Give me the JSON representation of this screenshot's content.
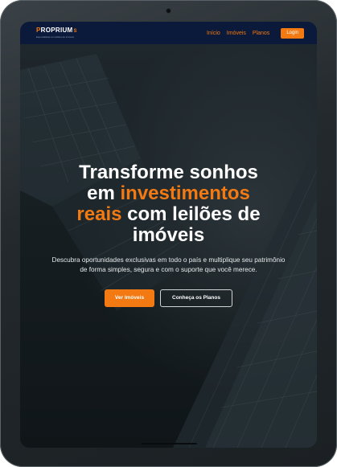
{
  "logo": {
    "p": "P",
    "rest": "ROPRIUM",
    "tail": "S",
    "tagline": "Especialistas em leilões de imóveis"
  },
  "nav": {
    "links": [
      "Início",
      "Imóveis",
      "Planos"
    ],
    "login": "Login"
  },
  "hero": {
    "title_line1": "Transforme sonhos",
    "title_em": "em ",
    "title_accent1": "investimentos",
    "title_accent2": "reais",
    "title_mid": " com leilões de",
    "title_line4": "imóveis",
    "subtitle": "Descubra oportunidades exclusivas em todo o país e multiplique seu patrimônio de forma simples, segura e com o suporte que você merece.",
    "cta_primary": "Ver Imóveis",
    "cta_secondary": "Conheça os Planos"
  },
  "colors": {
    "accent": "#f37a12",
    "navbar": "#0b1a3a"
  }
}
